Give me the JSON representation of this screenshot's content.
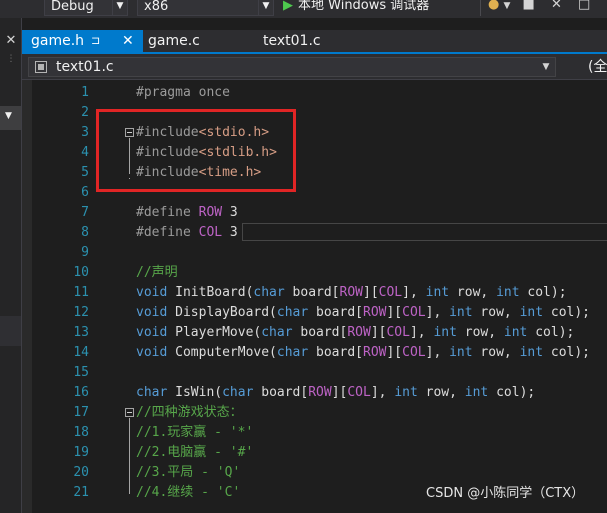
{
  "toolbar": {
    "config": "Debug",
    "platform": "x86",
    "run_label": "本地 Windows 调试器",
    "run_icon": "▶",
    "dropdown_arrow": "▼"
  },
  "tabs": [
    {
      "label": "game.h",
      "active": true,
      "pin": "⊐",
      "close": "✕"
    },
    {
      "label": "game.c",
      "active": false
    },
    {
      "label": "text01.c",
      "active": false
    }
  ],
  "navbar": {
    "file": "text01.c",
    "right_label": "(全"
  },
  "left_strip": {
    "close": "✕",
    "dropdown_arrow": "▼"
  },
  "code": {
    "line_numbers": [
      "1",
      "2",
      "3",
      "4",
      "5",
      "6",
      "7",
      "8",
      "9",
      "10",
      "11",
      "12",
      "13",
      "14",
      "15",
      "16",
      "17",
      "18",
      "19",
      "20",
      "21"
    ],
    "lines": [
      "#pragma once",
      "",
      "#include<stdio.h>",
      "#include<stdlib.h>",
      "#include<time.h>",
      "",
      "#define ROW 3",
      "#define COL 3",
      "",
      "//声明",
      "void InitBoard(char board[ROW][COL], int row, int col);",
      "void DisplayBoard(char board[ROW][COL], int row, int col);",
      "void PlayerMove(char board[ROW][COL], int row, int col);",
      "void ComputerMove(char board[ROW][COL], int row, int col);",
      "",
      "char IsWin(char board[ROW][COL], int row, int col);",
      "//四种游戏状态：",
      "//1.玩家赢 - '*'",
      "//2.电脑赢 - '#'",
      "//3.平局 - 'Q'",
      "//4.继续 - 'C'"
    ]
  },
  "colors": {
    "accent": "#007acc",
    "highlight_box": "#e12525",
    "keyword": "#569cd6",
    "macro": "#bd63c5",
    "comment": "#57a64a",
    "include_path": "#d69d85",
    "line_number": "#2b91af"
  },
  "watermark": "CSDN @小陈同学（CTX）"
}
